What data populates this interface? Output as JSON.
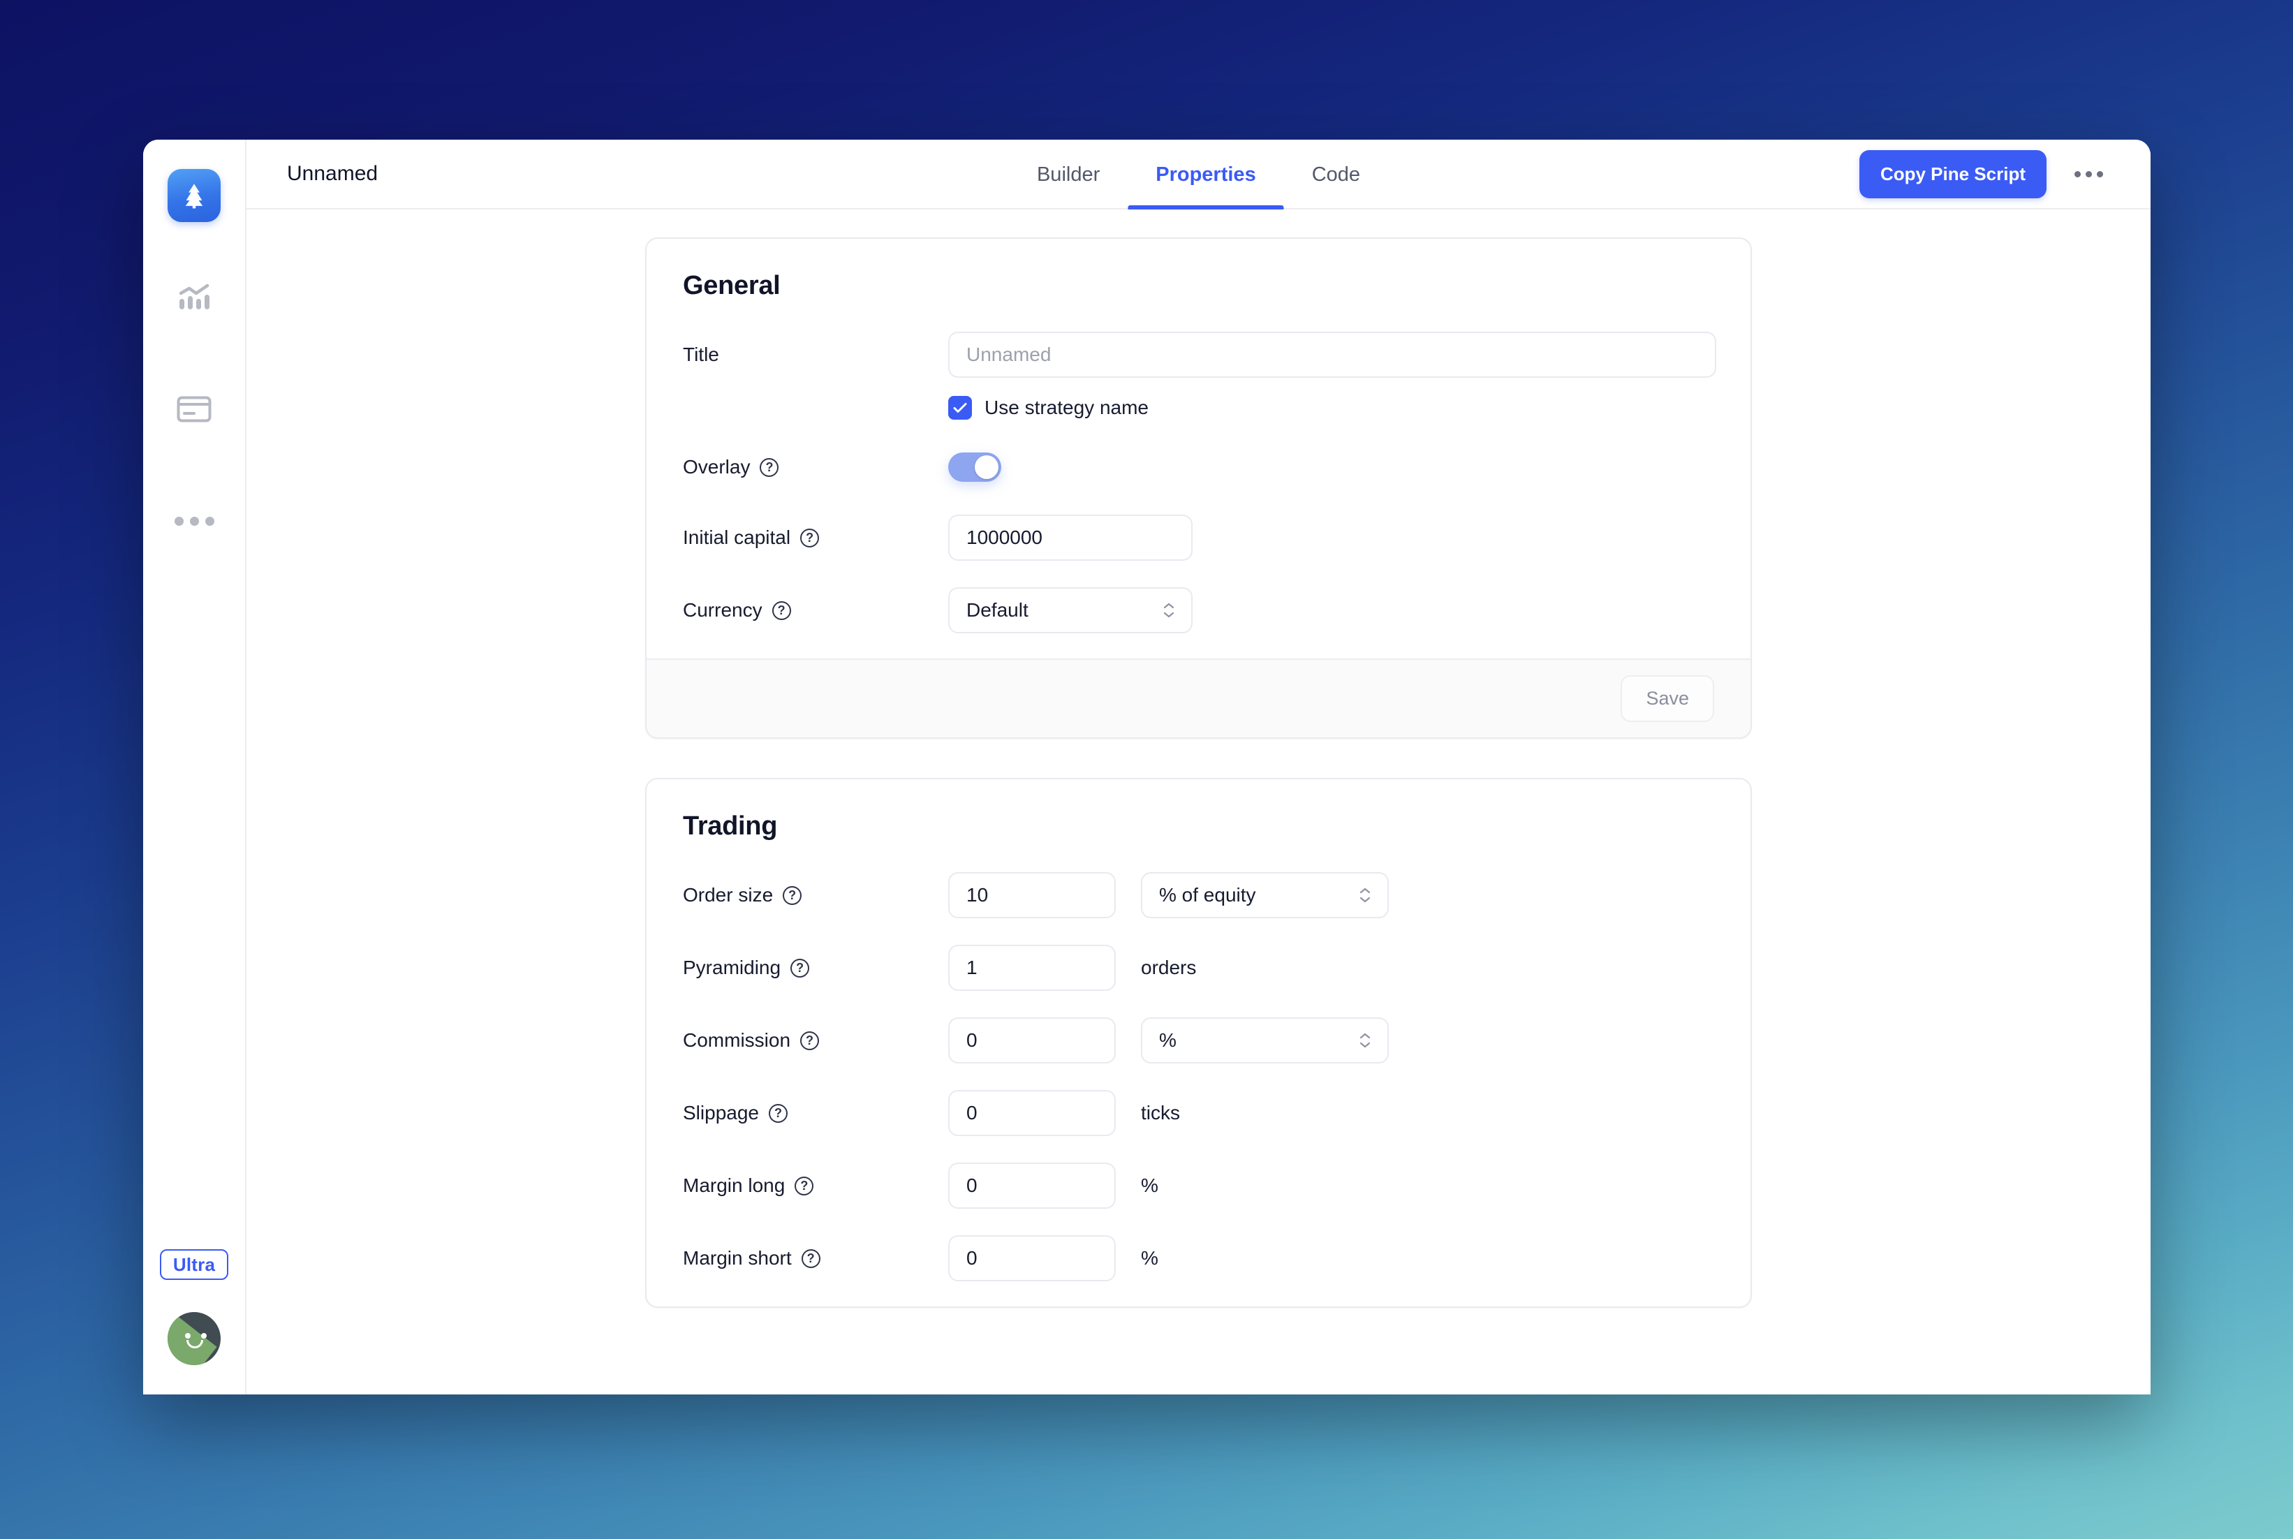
{
  "app": {
    "document_title": "Unnamed",
    "logo_icon": "pine-tree-logo",
    "nav_icons": [
      "chart-bars-icon",
      "credit-card-icon",
      "more-dots-icon"
    ],
    "plan_badge": "Ultra",
    "avatar_icon": "user-avatar-smiley"
  },
  "topbar": {
    "tabs": [
      {
        "label": "Builder",
        "active": false
      },
      {
        "label": "Properties",
        "active": true
      },
      {
        "label": "Code",
        "active": false
      }
    ],
    "primary_button": "Copy Pine Script",
    "overflow_icon": "kebab-menu-icon"
  },
  "general": {
    "title": "General",
    "rows": {
      "title": {
        "label": "Title",
        "placeholder": "Unnamed",
        "value": ""
      },
      "use_strategy_name": {
        "label": "Use strategy name",
        "checked": true
      },
      "overlay": {
        "label": "Overlay",
        "help": "?",
        "enabled": true
      },
      "initial_capital": {
        "label": "Initial capital",
        "help": "?",
        "value": "1000000"
      },
      "currency": {
        "label": "Currency",
        "help": "?",
        "value": "Default"
      }
    },
    "save_label": "Save"
  },
  "trading": {
    "title": "Trading",
    "rows": [
      {
        "label": "Order size",
        "help": "?",
        "value": "10",
        "unit_select": "% of equity",
        "unit_text": ""
      },
      {
        "label": "Pyramiding",
        "help": "?",
        "value": "1",
        "unit_select": "",
        "unit_text": "orders"
      },
      {
        "label": "Commission",
        "help": "?",
        "value": "0",
        "unit_select": "%",
        "unit_text": ""
      },
      {
        "label": "Slippage",
        "help": "?",
        "value": "0",
        "unit_select": "",
        "unit_text": "ticks"
      },
      {
        "label": "Margin long",
        "help": "?",
        "value": "0",
        "unit_select": "",
        "unit_text": "%"
      },
      {
        "label": "Margin short",
        "help": "?",
        "value": "0",
        "unit_select": "",
        "unit_text": "%"
      }
    ]
  },
  "colors": {
    "accent": "#3b5bf5",
    "toggle_on": "#8ea5ef",
    "text": "#171b2e",
    "muted_text": "#9da1ad",
    "border": "#e8eaf0",
    "bg_gradient_top": "#0d1263",
    "bg_gradient_bottom": "#7ccbcd"
  }
}
